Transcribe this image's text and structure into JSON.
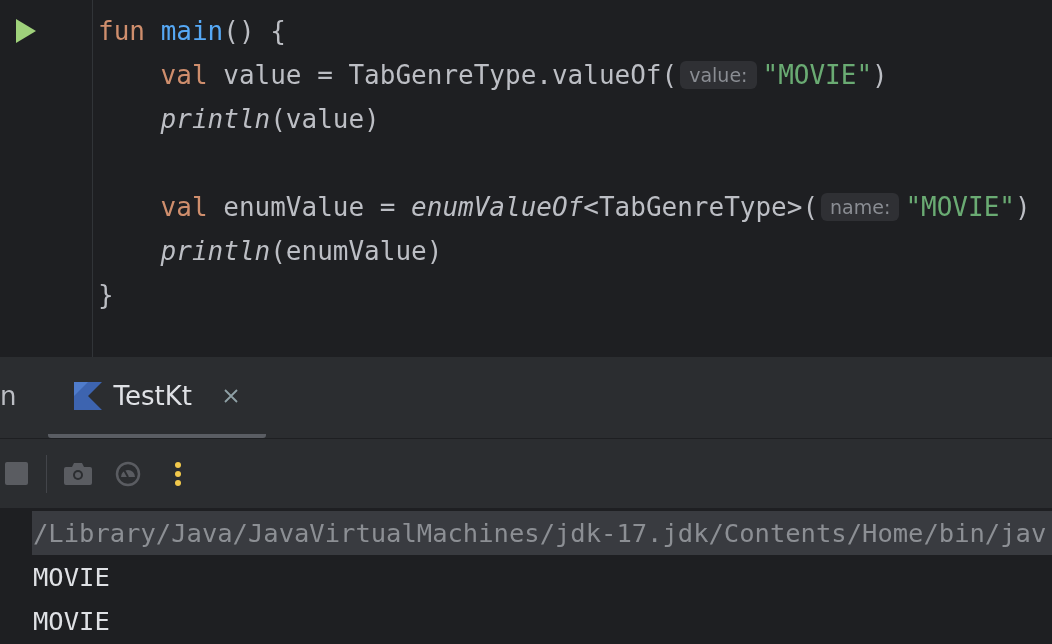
{
  "editor": {
    "lines": [
      {
        "kind": "code",
        "runnable": true,
        "segments": [
          {
            "kind": "code",
            "tokens": [
              {
                "kind": "keyword",
                "text": "fun "
              },
              {
                "kind": "function",
                "text": "main"
              },
              {
                "kind": "plain",
                "text": "() {"
              }
            ]
          }
        ]
      },
      {
        "kind": "code",
        "runnable": false,
        "segments": [
          {
            "kind": "code",
            "tokens": [
              {
                "kind": "keyword",
                "text": "    val "
              },
              {
                "kind": "plain",
                "text": "value = TabGenreType.valueOf("
              }
            ]
          },
          {
            "kind": "hint",
            "text": "value:"
          },
          {
            "kind": "code",
            "tokens": [
              {
                "kind": "string",
                "text": "\"MOVIE\""
              },
              {
                "kind": "plain",
                "text": ")"
              }
            ]
          }
        ]
      },
      {
        "kind": "code",
        "runnable": false,
        "segments": [
          {
            "kind": "code",
            "tokens": [
              {
                "kind": "call",
                "text": "    println"
              },
              {
                "kind": "plain",
                "text": "(value)"
              }
            ]
          }
        ]
      },
      {
        "kind": "blank"
      },
      {
        "kind": "code",
        "runnable": false,
        "segments": [
          {
            "kind": "code",
            "tokens": [
              {
                "kind": "keyword",
                "text": "    val "
              },
              {
                "kind": "plain",
                "text": "enumValue = "
              },
              {
                "kind": "call",
                "text": "enumValueOf"
              },
              {
                "kind": "plain",
                "text": "<TabGenreType>("
              }
            ]
          },
          {
            "kind": "hint",
            "text": "name:"
          },
          {
            "kind": "code",
            "tokens": [
              {
                "kind": "string",
                "text": "\"MOVIE\""
              },
              {
                "kind": "plain",
                "text": ")"
              }
            ]
          }
        ]
      },
      {
        "kind": "code",
        "runnable": false,
        "segments": [
          {
            "kind": "code",
            "tokens": [
              {
                "kind": "call",
                "text": "    println"
              },
              {
                "kind": "plain",
                "text": "(enumValue)"
              }
            ]
          }
        ]
      },
      {
        "kind": "code",
        "runnable": false,
        "segments": [
          {
            "kind": "code",
            "tokens": [
              {
                "kind": "plain",
                "text": "}"
              }
            ]
          }
        ]
      }
    ]
  },
  "run_panel": {
    "tabs": [
      {
        "label": "n",
        "selected": false,
        "icon": false,
        "closable": false
      },
      {
        "label": "TestKt",
        "selected": true,
        "icon": true,
        "closable": true
      }
    ],
    "console": [
      {
        "kind": "command",
        "text": "/Library/Java/JavaVirtualMachines/jdk-17.jdk/Contents/Home/bin/jav"
      },
      {
        "kind": "output",
        "text": "MOVIE"
      },
      {
        "kind": "output",
        "text": "MOVIE"
      }
    ]
  }
}
